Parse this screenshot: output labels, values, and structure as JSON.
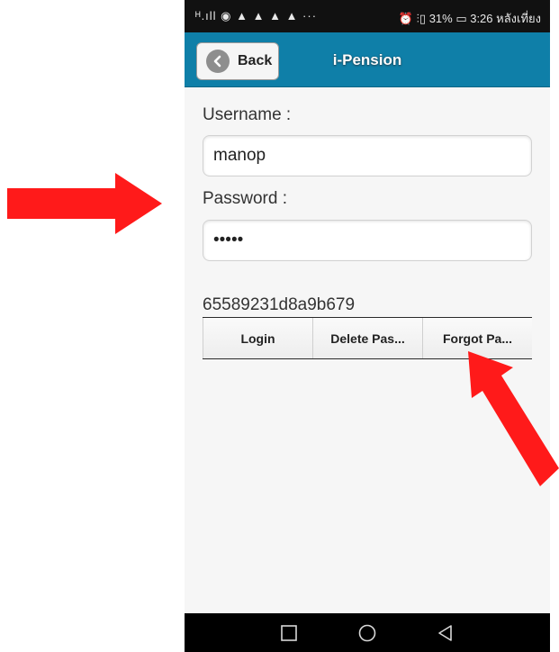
{
  "status_bar": {
    "left_icons": "ᴴ.ıll ◉ ▲ ▲ ▲ ▲ ···",
    "right_text": "⏰ ⫶▯ 31% ▭ 3:26 หลังเที่ยง"
  },
  "app_bar": {
    "back_label": "Back",
    "title": "i-Pension"
  },
  "form": {
    "username_label": "Username :",
    "username_value": "manop",
    "password_label": "Password :",
    "password_value": "•••••",
    "token_text": "65589231d8a9b679"
  },
  "buttons": {
    "login": "Login",
    "delete": "Delete Pas...",
    "forgot": "Forgot Pa..."
  },
  "nav_bar": {
    "icons": [
      "square-nav-icon",
      "circle-home-icon",
      "triangle-back-icon"
    ]
  },
  "colors": {
    "app_bar": "#0f7fa8",
    "annotation_arrow": "#ff1a1a"
  }
}
